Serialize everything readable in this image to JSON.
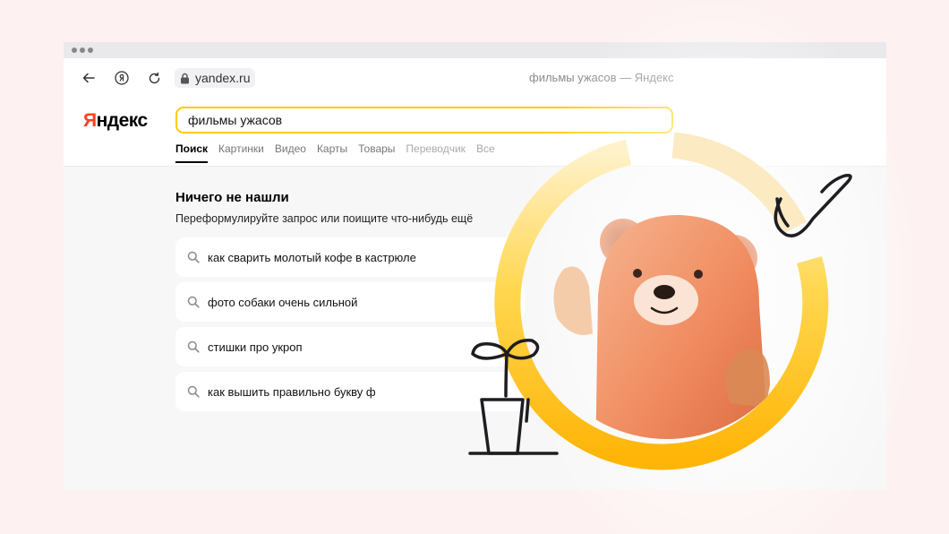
{
  "browser": {
    "back_icon": "arrow-left-icon",
    "yandex_icon": "yandex-browser-icon",
    "reload_icon": "reload-icon",
    "lock_icon": "lock-icon",
    "url": "yandex.ru",
    "tab_title": "фильмы ужасов — Яндекс"
  },
  "header": {
    "logo_first": "Я",
    "logo_rest": "ндекс",
    "search_value": "фильмы ужасов",
    "tabs": [
      {
        "label": "Поиск",
        "active": true
      },
      {
        "label": "Картинки"
      },
      {
        "label": "Видео"
      },
      {
        "label": "Карты"
      },
      {
        "label": "Товары"
      },
      {
        "label": "Переводчик"
      },
      {
        "label": "Все"
      }
    ]
  },
  "main": {
    "title": "Ничего не нашли",
    "subtitle": "Переформулируйте запрос или поищите что-нибудь ещё",
    "suggestions": [
      "как сварить молотый кофе в кастрюле",
      "фото собаки очень сильной",
      "стишки про укроп",
      "как вышить правильно букву ф"
    ]
  },
  "colors": {
    "accent": "#ffcc00",
    "logo_red": "#fc3f1d",
    "page_bg": "#fdf2f1"
  }
}
